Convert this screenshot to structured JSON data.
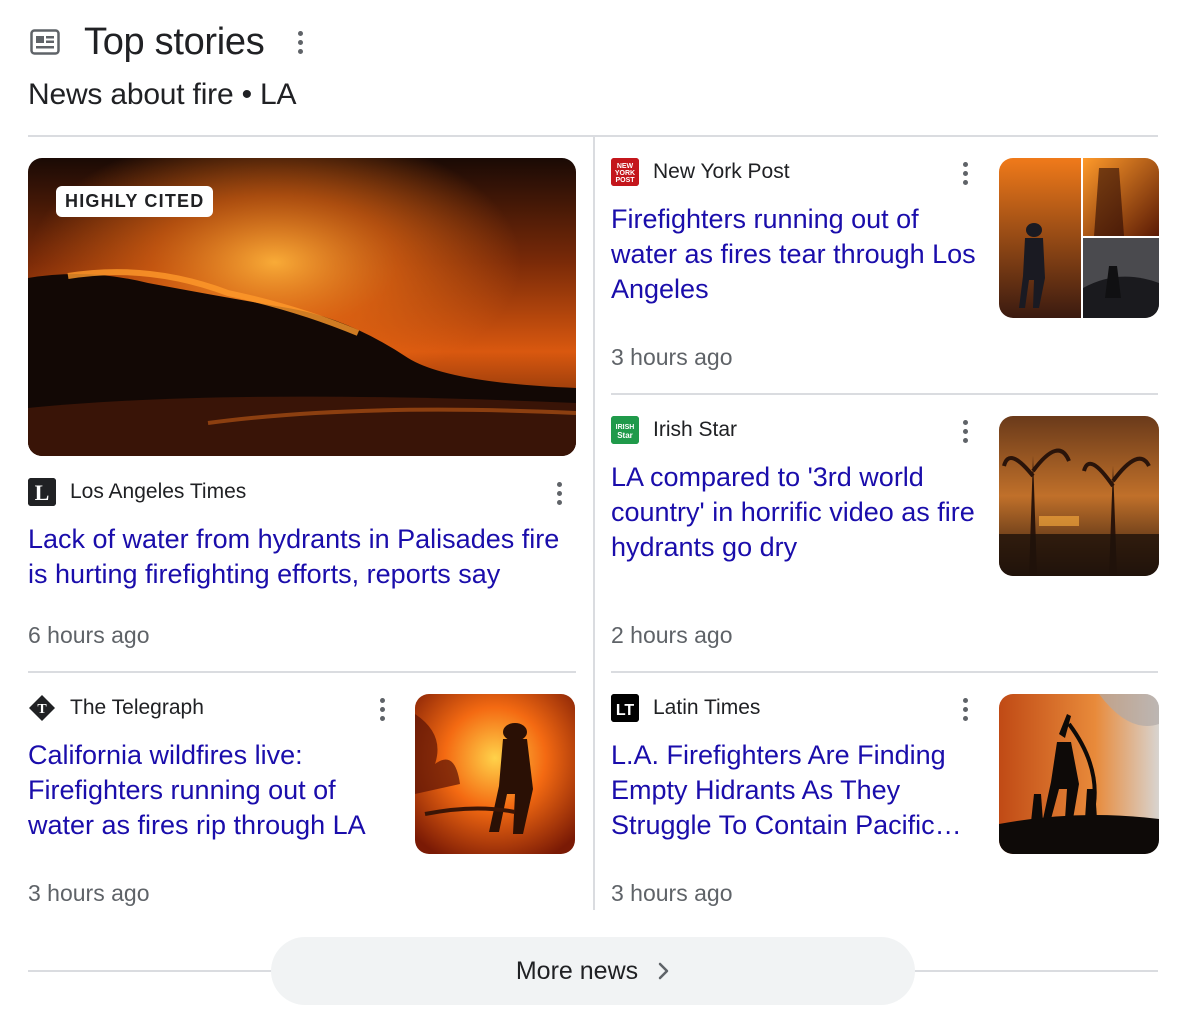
{
  "header": {
    "icon": "newspaper-icon",
    "title": "Top stories",
    "subtitle": "News about fire • LA",
    "menu_icon": "more-vert-icon"
  },
  "stories": [
    {
      "badge": "HIGHLY CITED",
      "source": "Los Angeles Times",
      "favicon": "la-times-logo",
      "headline": "Lack of water from hydrants in Palisades fire is hurting firefighting efforts, reports say",
      "time": "6 hours ago"
    },
    {
      "source": "New York Post",
      "favicon": "new-york-post-logo",
      "headline": "Firefighters running out of water as fires tear through Los Angeles",
      "time": "3 hours ago"
    },
    {
      "source": "Irish Star",
      "favicon": "irish-star-logo",
      "headline": "LA compared to '3rd world country' in horrific video as fire hydrants go dry",
      "time": "2 hours ago"
    },
    {
      "source": "The Telegraph",
      "favicon": "telegraph-logo",
      "headline": "California wildfires live: Firefighters running out of water as fires rip through LA",
      "time": "3 hours ago"
    },
    {
      "source": "Latin Times",
      "favicon": "latin-times-logo",
      "headline": "L.A. Firefighters Are Finding Empty Hidrants As They Struggle To Contain Pacific…",
      "time": "3 hours ago"
    }
  ],
  "footer": {
    "more_label": "More news",
    "more_icon": "chevron-right-icon"
  },
  "colors": {
    "link": "#1a0dab",
    "meta": "#5f6368",
    "divider": "#dadce0",
    "button_bg": "#f1f3f4"
  }
}
